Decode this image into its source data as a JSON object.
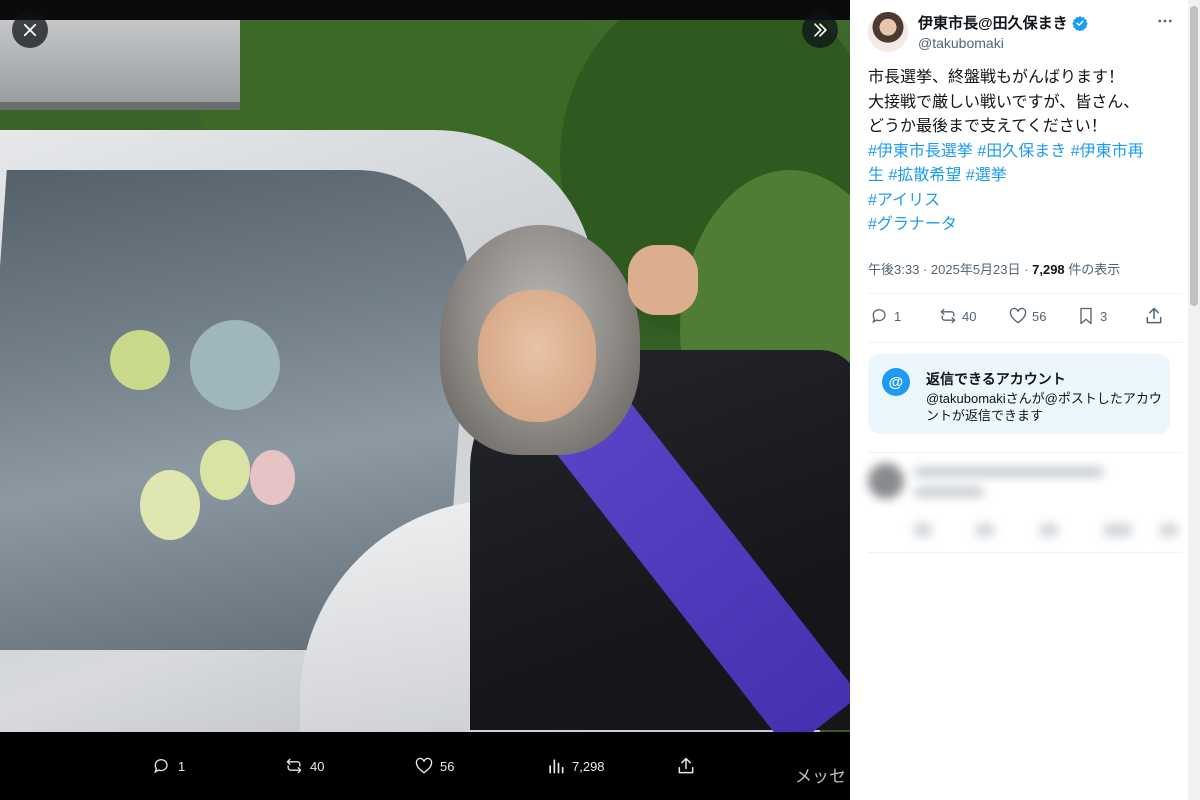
{
  "media_viewer": {
    "close_icon": "close-icon",
    "expand_icon": "chevrons-right-icon",
    "actions": {
      "reply_count": "1",
      "repost_count": "40",
      "like_count": "56",
      "view_count": "7,298"
    }
  },
  "tweet": {
    "author": {
      "display_name": "伊東市長@田久保まき",
      "handle": "@takubomaki",
      "verified": true
    },
    "text_lines": [
      "市長選挙、終盤戦もがんばります！",
      "大接戦で厳しい戦いですが、皆さん、",
      "どうか最後まで支えてください！"
    ],
    "hashtags": {
      "l1a": "#伊東市長選挙",
      "l1b": "#田久保まき",
      "l1c": "#伊東市再",
      "l2a": "生",
      "l2b": "#拡散希望",
      "l2c": "#選挙",
      "l3": "#アイリス",
      "l4": "#グラナータ"
    },
    "meta": {
      "time": "午後3:33",
      "separator": "·",
      "date": "2025年5月23日",
      "views": "7,298",
      "views_label": "件の表示"
    },
    "actions": {
      "reply_count": "1",
      "repost_count": "40",
      "like_count": "56",
      "bookmark_count": "3"
    },
    "reply_restriction": {
      "icon": "@",
      "title": "返信できるアカウント",
      "description": "@takubomakiさんが@ポストしたアカウントが返信できます"
    }
  },
  "messages_peek": "メッセ",
  "colors": {
    "accent": "#1d9bf0",
    "text": "#0f1419",
    "muted": "#536471",
    "reply_box_bg": "#ecf6fd"
  }
}
